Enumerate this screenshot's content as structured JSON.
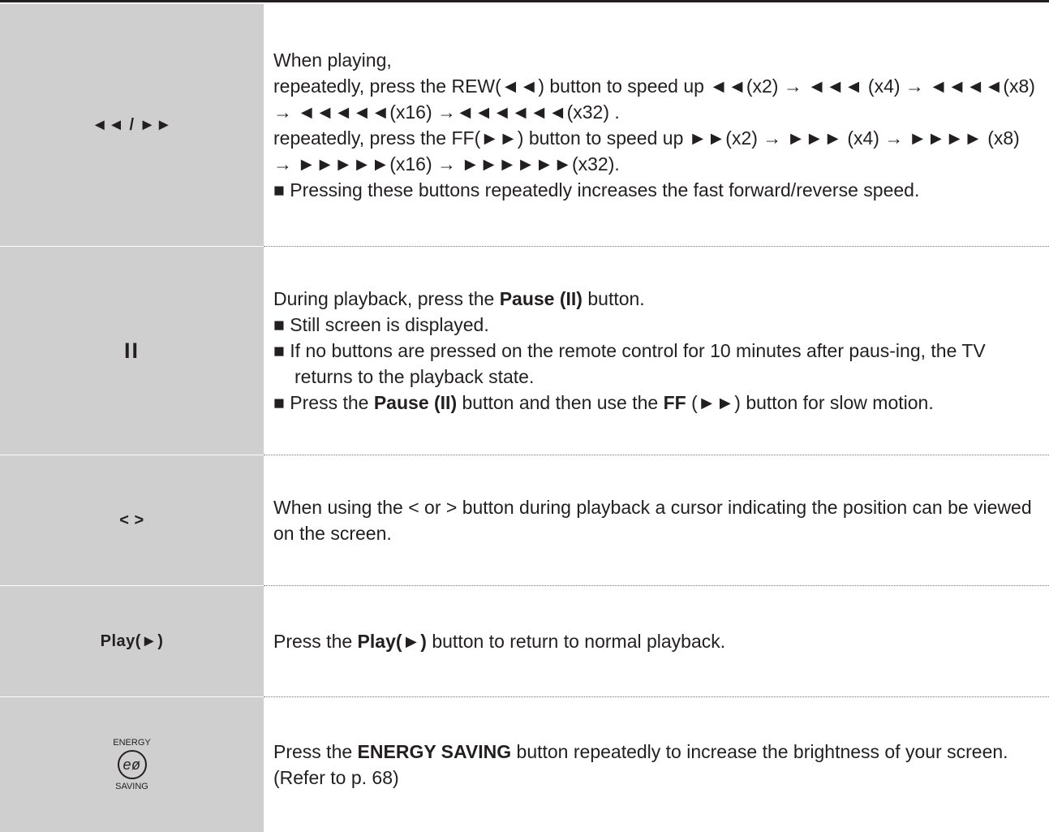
{
  "rows": [
    {
      "key": "◄◄ / ►►",
      "lines": [
        "When playing,",
        "repeatedly, press the REW(◄◄) button to speed up ◄◄(x2) → ◄◄◄ (x4) → ◄◄◄◄(x8) → ◄◄◄◄◄(x16) →◄◄◄◄◄◄(x32) .",
        "repeatedly, press the FF(►►) button to speed up ►►(x2) → ►►► (x4) → ►►►► (x8) → ►►►►►(x16) → ►►►►►►(x32)."
      ],
      "bullets": [
        "Pressing these buttons repeatedly increases the fast forward/reverse speed."
      ]
    },
    {
      "key": "II",
      "line_pre": "During playback, press the ",
      "line_bold": "Pause (II)",
      "line_post": " button.",
      "bullet1": "Still screen is displayed.",
      "bullet2": "If no buttons are pressed on the remote control for 10 minutes after paus-ing, the TV returns to the playback state.",
      "bullet3_pre": "Press the ",
      "bullet3_bold1": "Pause (II)",
      "bullet3_mid": " button and then use the ",
      "bullet3_bold2": "FF",
      "bullet3_post": " (►►) button for slow motion."
    },
    {
      "key": "< >",
      "text": "When using the < or > button during playback a cursor indicating the position can be viewed on the screen."
    },
    {
      "key": "Play(►)",
      "pre": "Press the ",
      "bold": "Play(►)",
      "post": " button to return to normal playback."
    },
    {
      "key_top": "ENERGY",
      "key_icon": "eø",
      "key_bottom": "SAVING",
      "pre": "Press the ",
      "bold": "ENERGY SAVING",
      "post": " button repeatedly to increase the brightness of your screen. (Refer to p. 68)"
    }
  ],
  "bullet_glyph": "■"
}
